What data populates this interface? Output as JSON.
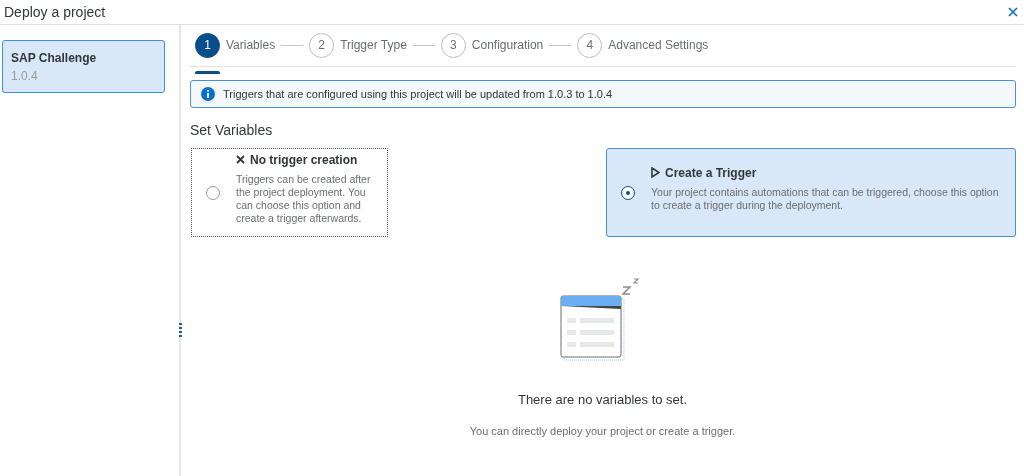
{
  "window": {
    "title": "Deploy a project"
  },
  "sidebar": {
    "items": [
      {
        "name": "SAP Challenge",
        "version": "1.0.4",
        "selected": true
      }
    ]
  },
  "steps": [
    {
      "number": "1",
      "label": "Variables",
      "selected": true
    },
    {
      "number": "2",
      "label": "Trigger Type",
      "selected": false
    },
    {
      "number": "3",
      "label": "Configuration",
      "selected": false
    },
    {
      "number": "4",
      "label": "Advanced Settings",
      "selected": false
    }
  ],
  "info_strip": {
    "text": "Triggers that are configured using this project will be updated from 1.0.3 to 1.0.4"
  },
  "section_title": "Set Variables",
  "options": [
    {
      "kind": "cross",
      "title": "No trigger creation",
      "description": "Triggers can be created after the project deployment. You can choose this option and create a trigger afterwards.",
      "selected": false
    },
    {
      "kind": "play",
      "title": "Create a Trigger",
      "description": "Your project contains automations that can be triggered, choose this option to create a trigger during the deployment.",
      "selected": true
    }
  ],
  "empty_state": {
    "title": "There are no variables to set.",
    "subtitle": "You can directly deploy your project or create a trigger."
  }
}
